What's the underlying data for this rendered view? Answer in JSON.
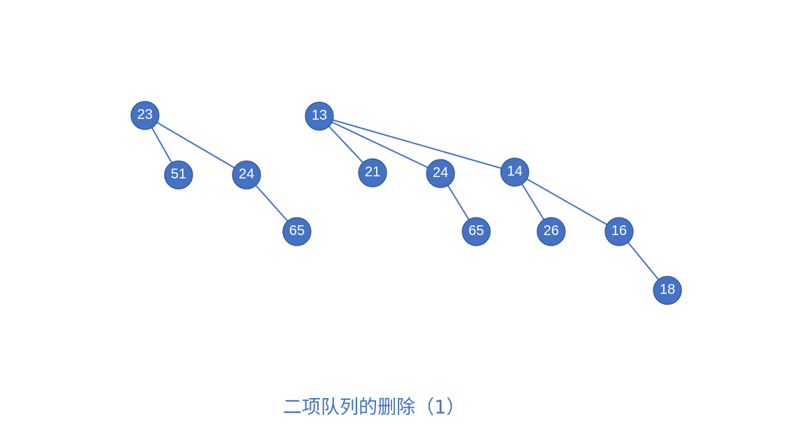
{
  "caption": "二项队列的删除（1）",
  "colors": {
    "node_fill": "#4472c4",
    "node_border": "#2f528f",
    "edge": "#4472c4",
    "label": "#ffffff",
    "caption": "#4472c4"
  },
  "trees": [
    {
      "root": "23",
      "nodes": [
        {
          "id": "t1-23",
          "label": "23"
        },
        {
          "id": "t1-51",
          "label": "51"
        },
        {
          "id": "t1-24",
          "label": "24"
        },
        {
          "id": "t1-65",
          "label": "65"
        }
      ],
      "edges": [
        [
          "t1-23",
          "t1-51"
        ],
        [
          "t1-23",
          "t1-24"
        ],
        [
          "t1-24",
          "t1-65"
        ]
      ]
    },
    {
      "root": "13",
      "nodes": [
        {
          "id": "t2-13",
          "label": "13"
        },
        {
          "id": "t2-21",
          "label": "21"
        },
        {
          "id": "t2-24",
          "label": "24"
        },
        {
          "id": "t2-14",
          "label": "14"
        },
        {
          "id": "t2-65",
          "label": "65"
        },
        {
          "id": "t2-26",
          "label": "26"
        },
        {
          "id": "t2-16",
          "label": "16"
        },
        {
          "id": "t2-18",
          "label": "18"
        }
      ],
      "edges": [
        [
          "t2-13",
          "t2-21"
        ],
        [
          "t2-13",
          "t2-24"
        ],
        [
          "t2-13",
          "t2-14"
        ],
        [
          "t2-24",
          "t2-65"
        ],
        [
          "t2-14",
          "t2-26"
        ],
        [
          "t2-14",
          "t2-16"
        ],
        [
          "t2-16",
          "t2-18"
        ]
      ]
    }
  ]
}
